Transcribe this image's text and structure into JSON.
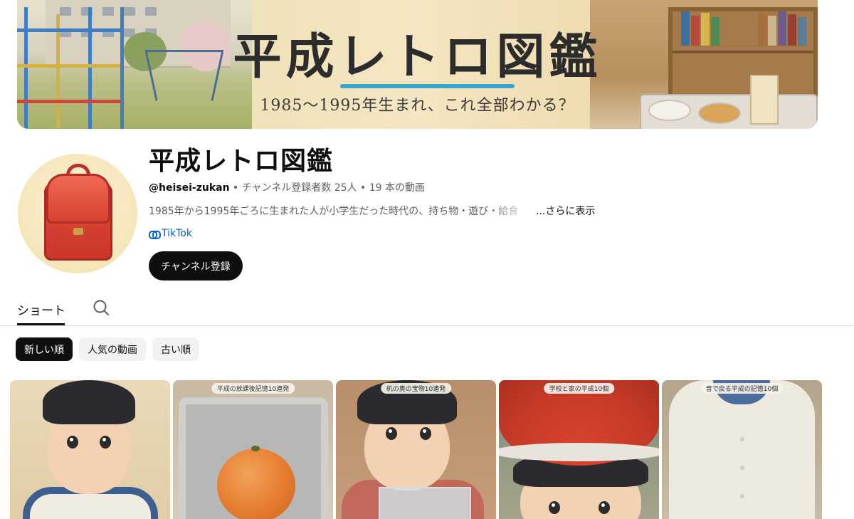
{
  "banner": {
    "title": "平成レトロ図鑑",
    "subtitle": "1985〜1995年生まれ、これ全部わかる？"
  },
  "channel": {
    "name": "平成レトロ図鑑",
    "handle": "@heisei-zukan",
    "meta": " • チャンネル登録者数 25人 • 19 本の動画",
    "description": "1985年から1995年ごろに生まれた人が小学生だった時代の、持ち物・遊び・給食",
    "more_label": "...さらに表示",
    "link_label": "TikTok",
    "subscribe_label": "チャンネル登録"
  },
  "tabs": {
    "shorts_label": "ショート"
  },
  "chips": [
    "新しい順",
    "人気の動画",
    "古い順"
  ],
  "shorts": [
    {
      "label": ""
    },
    {
      "label": "平成の放課後記憶10連発"
    },
    {
      "label": "机の奥の宝物10連発"
    },
    {
      "label": "学校と家の平成10個"
    },
    {
      "label": "音で戻る平成の記憶10個"
    }
  ],
  "colors": {
    "accent_line": "#3aa4c9",
    "subscribe_bg": "#0f0f0f",
    "link": "#065fd4"
  }
}
